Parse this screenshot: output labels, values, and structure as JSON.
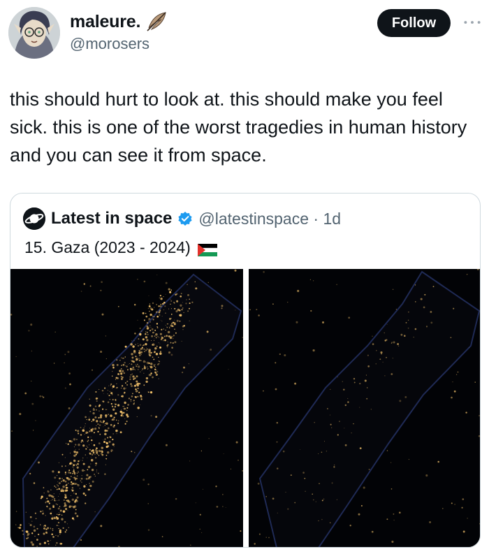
{
  "author": {
    "display_name": "maleure.",
    "handle": "@morosers",
    "follow_label": "Follow"
  },
  "tweet": {
    "text": "this should hurt to look at. this should make you feel sick. this is one of the worst tragedies in human history and you can see it from space."
  },
  "quote": {
    "name": "Latest in space",
    "handle_time": "@latestinspace · 1d",
    "text": "15. Gaza (2023 - 2024)"
  },
  "icons": {
    "quill": "quill-emoji-icon",
    "more": "more-horizontal-icon",
    "verified": "verified-badge-icon",
    "flag": "palestine-flag-icon",
    "logo": "planet-logo-icon"
  },
  "colors": {
    "follow_bg": "#0f1419",
    "secondary_text": "#536471",
    "verified_blue": "#1d9bf0",
    "night_bg": "#020306",
    "city_light": "#f3c26b"
  }
}
